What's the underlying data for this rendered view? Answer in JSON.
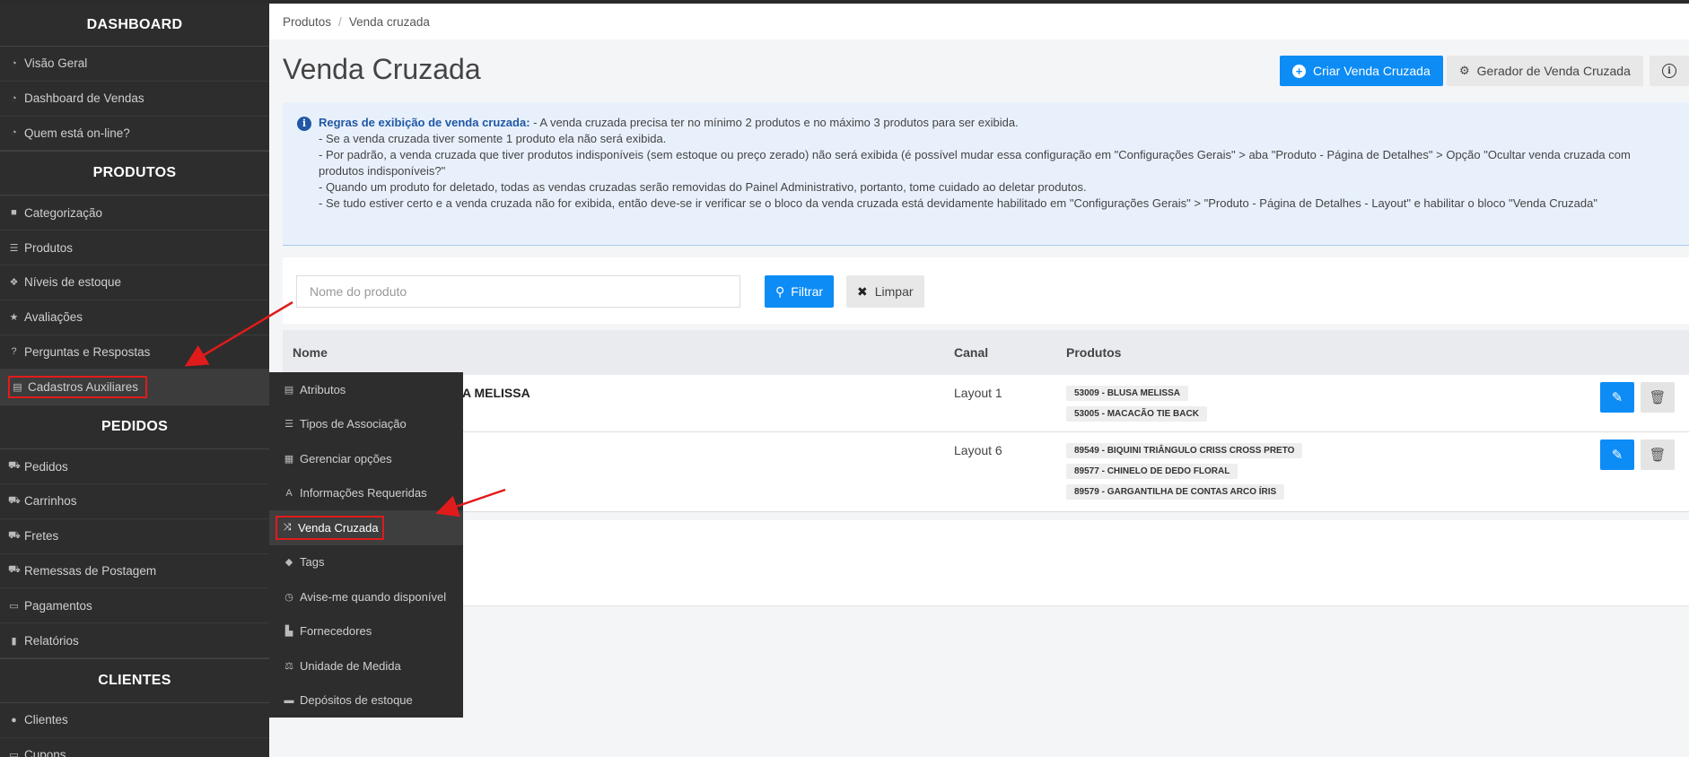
{
  "sidebar": {
    "sections": [
      {
        "title": "DASHBOARD",
        "items": [
          {
            "label": "Visão Geral",
            "icon": "dashboard-icon"
          },
          {
            "label": "Dashboard de Vendas",
            "icon": "dashboard-icon"
          },
          {
            "label": "Quem está on-line?",
            "icon": "dashboard-icon"
          }
        ]
      },
      {
        "title": "PRODUTOS",
        "items": [
          {
            "label": "Categorização",
            "icon": "folder-icon"
          },
          {
            "label": "Produtos",
            "icon": "list-icon"
          },
          {
            "label": "Níveis de estoque",
            "icon": "cubes-icon"
          },
          {
            "label": "Avaliações",
            "icon": "star-icon"
          },
          {
            "label": "Perguntas e Respostas",
            "icon": "question-icon"
          },
          {
            "label": "Cadastros Auxiliares",
            "icon": "file-icon"
          }
        ]
      },
      {
        "title": "PEDIDOS",
        "items": [
          {
            "label": "Pedidos",
            "icon": "cart-icon"
          },
          {
            "label": "Carrinhos",
            "icon": "cart-icon"
          },
          {
            "label": "Fretes",
            "icon": "truck-icon"
          },
          {
            "label": "Remessas de Postagem",
            "icon": "truck-icon"
          },
          {
            "label": "Pagamentos",
            "icon": "credit-card-icon"
          },
          {
            "label": "Relatórios",
            "icon": "bar-chart-icon"
          }
        ]
      },
      {
        "title": "CLIENTES",
        "items": [
          {
            "label": "Clientes",
            "icon": "user-icon"
          },
          {
            "label": "Cupons",
            "icon": "ticket-icon"
          }
        ]
      }
    ]
  },
  "submenu": [
    {
      "label": "Atributos",
      "icon": "list-alt-icon"
    },
    {
      "label": "Tipos de Associação",
      "icon": "tasks-icon"
    },
    {
      "label": "Gerenciar opções",
      "icon": "grid-icon"
    },
    {
      "label": "Informações Requeridas",
      "icon": "font-icon"
    },
    {
      "label": "Venda Cruzada",
      "icon": "random-icon"
    },
    {
      "label": "Tags",
      "icon": "tag-icon"
    },
    {
      "label": "Avise-me quando disponível",
      "icon": "clock-icon"
    },
    {
      "label": "Fornecedores",
      "icon": "industry-icon"
    },
    {
      "label": "Unidade de Medida",
      "icon": "balance-scale-icon"
    },
    {
      "label": "Depósitos de estoque",
      "icon": "archive-icon"
    }
  ],
  "breadcrumb": {
    "root": "Produtos",
    "current": "Venda cruzada"
  },
  "page_title": "Venda Cruzada",
  "toolbar": {
    "create_label": "Criar Venda Cruzada",
    "generator_label": "Gerador de Venda Cruzada"
  },
  "info": {
    "title": "Regras de exibição de venda cruzada:",
    "line1": " - A venda cruzada precisa ter no mínimo 2 produtos e no máximo 3 produtos para ser exibida.",
    "line2": "- Se a venda cruzada tiver somente 1 produto ela não será exibida.",
    "line3": "- Por padrão, a venda cruzada que tiver produtos indisponíveis (sem estoque ou preço zerado) não será exibida (é possível mudar essa configuração em \"Configurações Gerais\" > aba \"Produto - Página de Detalhes\" > Opção \"Ocultar venda cruzada com produtos indisponíveis?\"",
    "line4": "- Quando um produto for deletado, todas as vendas cruzadas serão removidas do Painel Administrativo, portanto, tome cuidado ao deletar produtos.",
    "line5": "- Se tudo estiver certo e a venda cruzada não for exibida, então deve-se ir verificar se o bloco da venda cruzada está devidamente habilitado em \"Configurações Gerais\" > \"Produto - Página de Detalhes - Layout\" e habilitar o bloco \"Venda Cruzada\""
  },
  "filter": {
    "placeholder": "Nome do produto",
    "filter_label": "Filtrar",
    "clear_label": "Limpar"
  },
  "table": {
    "columns": [
      "Nome",
      "Canal",
      "Produtos"
    ],
    "rows": [
      {
        "name": "MACACÃO TIE BACK, BLUSA MELISSA",
        "canal": "Layout 1",
        "products": [
          "53009 - BLUSA MELISSA",
          "53005 - MACACÃO TIE BACK"
        ]
      },
      {
        "name": "",
        "canal": "Layout 6",
        "products": [
          "89549 - BIQUINI TRIÂNGULO CRISS CROSS PRETO",
          "89577 - CHINELO DE DEDO FLORAL",
          "89579 - GARGANTILHA DE CONTAS ARCO ÍRIS"
        ]
      }
    ]
  },
  "colors": {
    "primary": "#0d8cf5",
    "sidebar": "#2d2d2d",
    "highlight": "#e01b1b",
    "info_bg": "#e8f1fb"
  }
}
